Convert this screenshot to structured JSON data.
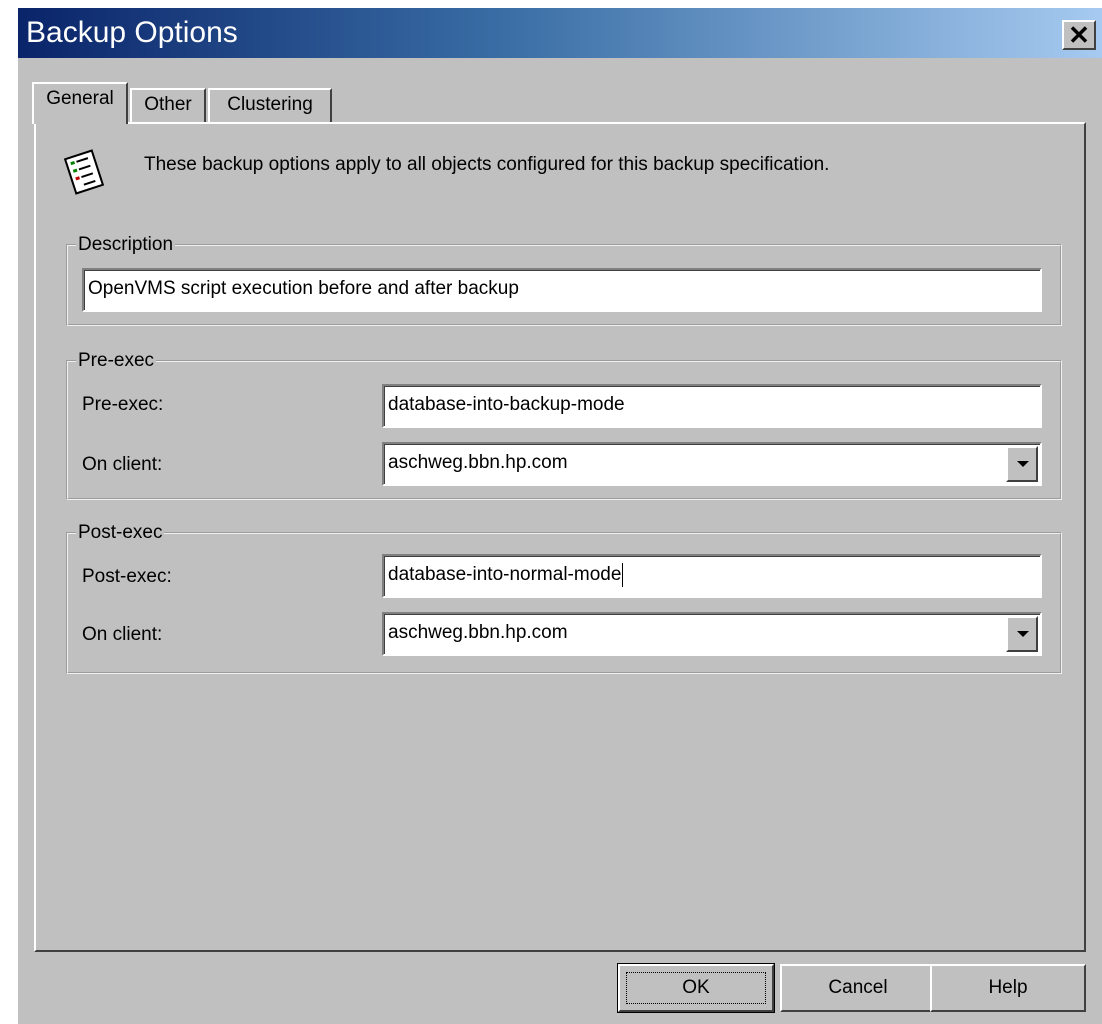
{
  "window": {
    "title": "Backup Options",
    "close_label": "✕"
  },
  "tabs": [
    {
      "label": "General",
      "active": true
    },
    {
      "label": "Other",
      "active": false
    },
    {
      "label": "Clustering",
      "active": false
    }
  ],
  "info": {
    "icon": "checklist-icon",
    "text": "These backup options apply to all objects configured for this backup specification."
  },
  "description": {
    "group_label": "Description",
    "value": "OpenVMS script execution before and after backup"
  },
  "pre_exec": {
    "group_label": "Pre-exec",
    "field_label": "Pre-exec:",
    "value": "database-into-backup-mode",
    "client_label": "On client:",
    "client_value": "aschweg.bbn.hp.com"
  },
  "post_exec": {
    "group_label": "Post-exec",
    "field_label": "Post-exec:",
    "value": "database-into-normal-mode",
    "client_label": "On client:",
    "client_value": "aschweg.bbn.hp.com"
  },
  "buttons": {
    "ok": "OK",
    "cancel": "Cancel",
    "help": "Help"
  }
}
